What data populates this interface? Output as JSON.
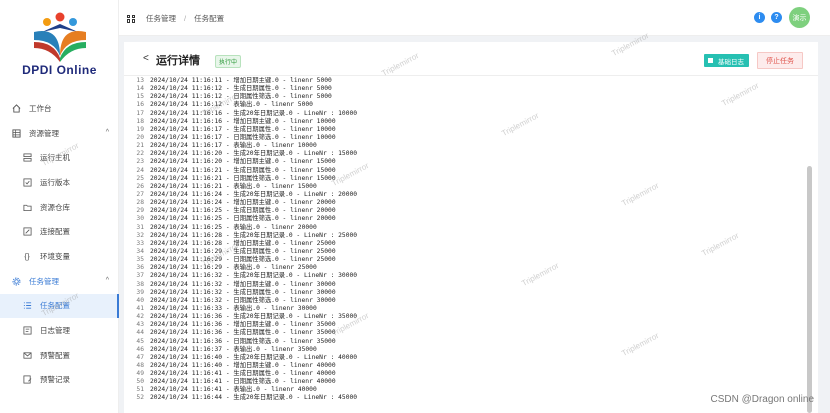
{
  "app": {
    "name": "DPDI Online"
  },
  "breadcrumb": {
    "items": [
      "任务管理",
      "任务配置"
    ]
  },
  "topbar": {
    "info_icon": "i",
    "help_icon": "?",
    "avatar_text": "演示"
  },
  "sidebar": {
    "items": [
      {
        "label": "工作台",
        "icon": "home-icon",
        "level": "top"
      },
      {
        "label": "资源管理",
        "icon": "grid-icon",
        "level": "top",
        "caret": "^"
      },
      {
        "label": "运行主机",
        "icon": "server-icon",
        "level": "sub"
      },
      {
        "label": "运行版本",
        "icon": "version-icon",
        "level": "sub"
      },
      {
        "label": "资源仓库",
        "icon": "folder-icon",
        "level": "sub"
      },
      {
        "label": "连接配置",
        "icon": "link-icon",
        "level": "sub"
      },
      {
        "label": "环境变量",
        "icon": "braces-icon",
        "level": "sub"
      },
      {
        "label": "任务管理",
        "icon": "gear-icon",
        "level": "top",
        "caret": "^"
      },
      {
        "label": "任务配置",
        "icon": "list-icon",
        "level": "sub"
      },
      {
        "label": "日志管理",
        "icon": "log-icon",
        "level": "sub"
      },
      {
        "label": "预警配置",
        "icon": "mail-icon",
        "level": "sub"
      },
      {
        "label": "预警记录",
        "icon": "record-icon",
        "level": "sub"
      }
    ]
  },
  "page": {
    "back": "<",
    "title": "运行详情",
    "status": "执行中",
    "log_button": "基础日志",
    "stop_button": "停止任务"
  },
  "log_lines": [
    {
      "no": "13",
      "text": "2024/10/24 11:16:11 - 增加日期主键.0 - linenr 5000"
    },
    {
      "no": "14",
      "text": "2024/10/24 11:16:12 - 生成日期属性.0 - linenr 5000"
    },
    {
      "no": "15",
      "text": "2024/10/24 11:16:12 - 日期属性筛选.0 - linenr 5000"
    },
    {
      "no": "16",
      "text": "2024/10/24 11:16:12 - 表输出.0 - linenr 5000"
    },
    {
      "no": "17",
      "text": "2024/10/24 11:16:16 - 生成20年日期记录.0 - LineNr : 10000"
    },
    {
      "no": "18",
      "text": "2024/10/24 11:16:16 - 增加日期主键.0 - linenr 10000"
    },
    {
      "no": "19",
      "text": "2024/10/24 11:16:17 - 生成日期属性.0 - linenr 10000"
    },
    {
      "no": "20",
      "text": "2024/10/24 11:16:17 - 日期属性筛选.0 - linenr 10000"
    },
    {
      "no": "21",
      "text": "2024/10/24 11:16:17 - 表输出.0 - linenr 10000"
    },
    {
      "no": "22",
      "text": "2024/10/24 11:16:20 - 生成20年日期记录.0 - LineNr : 15000"
    },
    {
      "no": "23",
      "text": "2024/10/24 11:16:20 - 增加日期主键.0 - linenr 15000"
    },
    {
      "no": "24",
      "text": "2024/10/24 11:16:21 - 生成日期属性.0 - linenr 15000"
    },
    {
      "no": "25",
      "text": "2024/10/24 11:16:21 - 日期属性筛选.0 - linenr 15000"
    },
    {
      "no": "26",
      "text": "2024/10/24 11:16:21 - 表输出.0 - linenr 15000"
    },
    {
      "no": "27",
      "text": "2024/10/24 11:16:24 - 生成20年日期记录.0 - LineNr : 20000"
    },
    {
      "no": "28",
      "text": "2024/10/24 11:16:24 - 增加日期主键.0 - linenr 20000"
    },
    {
      "no": "29",
      "text": "2024/10/24 11:16:25 - 生成日期属性.0 - linenr 20000"
    },
    {
      "no": "30",
      "text": "2024/10/24 11:16:25 - 日期属性筛选.0 - linenr 20000"
    },
    {
      "no": "31",
      "text": "2024/10/24 11:16:25 - 表输出.0 - linenr 20000"
    },
    {
      "no": "32",
      "text": "2024/10/24 11:16:28 - 生成20年日期记录.0 - LineNr : 25000"
    },
    {
      "no": "33",
      "text": "2024/10/24 11:16:28 - 增加日期主键.0 - linenr 25000"
    },
    {
      "no": "34",
      "text": "2024/10/24 11:16:29 - 生成日期属性.0 - linenr 25000"
    },
    {
      "no": "35",
      "text": "2024/10/24 11:16:29 - 日期属性筛选.0 - linenr 25000"
    },
    {
      "no": "36",
      "text": "2024/10/24 11:16:29 - 表输出.0 - linenr 25000"
    },
    {
      "no": "37",
      "text": "2024/10/24 11:16:32 - 生成20年日期记录.0 - LineNr : 30000"
    },
    {
      "no": "38",
      "text": "2024/10/24 11:16:32 - 增加日期主键.0 - linenr 30000"
    },
    {
      "no": "39",
      "text": "2024/10/24 11:16:32 - 生成日期属性.0 - linenr 30000"
    },
    {
      "no": "40",
      "text": "2024/10/24 11:16:32 - 日期属性筛选.0 - linenr 30000"
    },
    {
      "no": "41",
      "text": "2024/10/24 11:16:33 - 表输出.0 - linenr 30000"
    },
    {
      "no": "42",
      "text": "2024/10/24 11:16:36 - 生成20年日期记录.0 - LineNr : 35000"
    },
    {
      "no": "43",
      "text": "2024/10/24 11:16:36 - 增加日期主键.0 - linenr 35000"
    },
    {
      "no": "44",
      "text": "2024/10/24 11:16:36 - 生成日期属性.0 - linenr 35000"
    },
    {
      "no": "45",
      "text": "2024/10/24 11:16:36 - 日期属性筛选.0 - linenr 35000"
    },
    {
      "no": "46",
      "text": "2024/10/24 11:16:37 - 表输出.0 - linenr 35000"
    },
    {
      "no": "47",
      "text": "2024/10/24 11:16:40 - 生成20年日期记录.0 - LineNr : 40000"
    },
    {
      "no": "48",
      "text": "2024/10/24 11:16:40 - 增加日期主键.0 - linenr 40000"
    },
    {
      "no": "49",
      "text": "2024/10/24 11:16:41 - 生成日期属性.0 - linenr 40000"
    },
    {
      "no": "50",
      "text": "2024/10/24 11:16:41 - 日期属性筛选.0 - linenr 40000"
    },
    {
      "no": "51",
      "text": "2024/10/24 11:16:41 - 表输出.0 - linenr 40000"
    },
    {
      "no": "52",
      "text": "2024/10/24 11:16:44 - 生成20年日期记录.0 - LineNr : 45000"
    }
  ],
  "watermark": "Triplemirror",
  "footer_watermark": "CSDN @Dragon online"
}
